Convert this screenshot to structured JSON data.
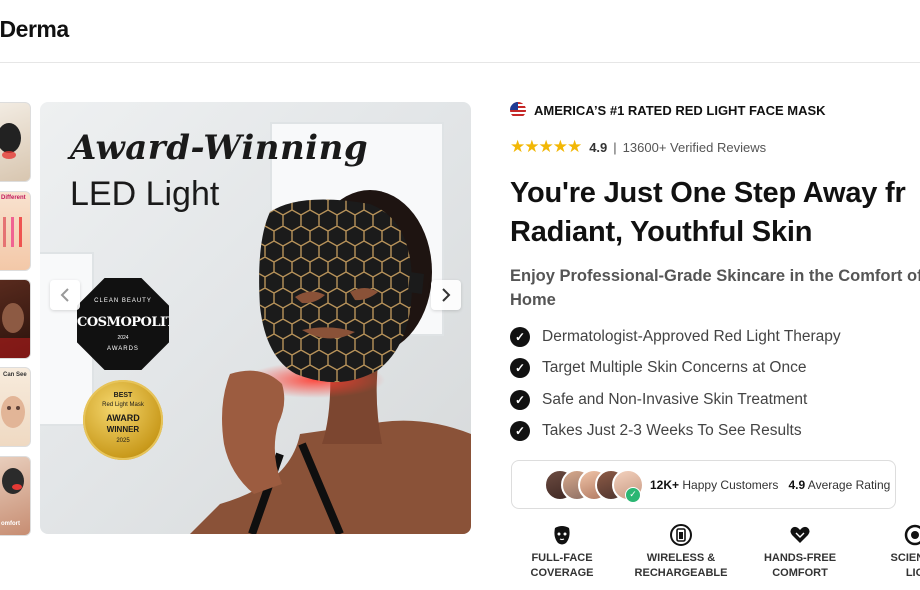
{
  "brand": {
    "logo_text": "oDerma"
  },
  "gallery": {
    "thumbnails": [
      {
        "label": ""
      },
      {
        "label": "Different"
      },
      {
        "label": ""
      },
      {
        "label": "Can See"
      },
      {
        "label": "omfort"
      }
    ],
    "hero": {
      "title_line1": "Award-Winning",
      "title_line2": "LED Light",
      "cosmo_badge": {
        "top": "CLEAN BEAUTY",
        "brand": "COSMOPOLITAN",
        "year": "2024",
        "bottom": "AWARDS"
      },
      "award_badge": {
        "line1": "BEST",
        "line2": "Red Light Mask",
        "line3": "AWARD",
        "line4": "WINNER",
        "line5": "2025"
      },
      "prev_icon": "chevron-left-icon",
      "next_icon": "chevron-right-icon"
    }
  },
  "product": {
    "rated_label": "AMERICA’S #1 RATED RED LIGHT FACE MASK",
    "rating": {
      "stars": "★★★★★",
      "value": "4.9",
      "separator": "|",
      "reviews": "13600+ Verified Reviews"
    },
    "headline_line1": "You're Just One Step Away fr",
    "headline_line2": "Radiant, Youthful Skin",
    "subhead_line1": "Enjoy Professional-Grade Skincare in the Comfort of",
    "subhead_line2": "Home",
    "benefits": [
      "Dermatologist-Approved Red Light Therapy",
      "Target Multiple Skin Concerns at Once",
      "Safe and Non-Invasive Skin Treatment",
      "Takes Just 2-3 Weeks To See Results"
    ],
    "social_proof": {
      "customers_count": "12K+",
      "customers_label": "Happy Customers",
      "avg_rating": "4.9",
      "avg_label": "Average Rating"
    },
    "features": [
      {
        "line1": "FULL-FACE",
        "line2": "COVERAGE",
        "icon": "mask-icon"
      },
      {
        "line1": "WIRELESS &",
        "line2": "RECHARGEABLE",
        "icon": "battery-icon"
      },
      {
        "line1": "HANDS-FREE",
        "line2": "COMFORT",
        "icon": "heart-hands-icon"
      },
      {
        "line1": "SCIENCE",
        "line2": "LIG",
        "icon": "light-icon"
      }
    ]
  },
  "colors": {
    "star": "#f2b705",
    "check_bg": "#111111",
    "verify": "#2bb673"
  }
}
